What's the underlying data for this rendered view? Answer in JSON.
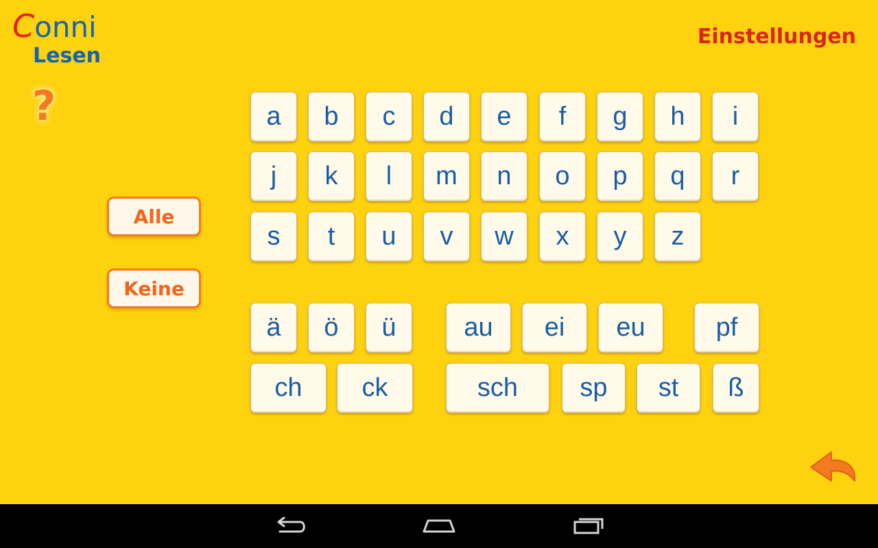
{
  "app": {
    "logo_line1_first": "C",
    "logo_line1_rest": "onni",
    "logo_line2": "Lesen",
    "help_symbol": "?",
    "settings_label": "Einstellungen",
    "colors": {
      "background": "#ffd20f",
      "key_text": "#1a5da4",
      "accent_orange": "#f47a20",
      "settings_red": "#d8261b"
    }
  },
  "side_buttons": {
    "all_label": "Alle",
    "none_label": "Keine"
  },
  "keys": {
    "row1": [
      "a",
      "b",
      "c",
      "d",
      "e",
      "f",
      "g",
      "h",
      "i"
    ],
    "row2": [
      "j",
      "k",
      "l",
      "m",
      "n",
      "o",
      "p",
      "q",
      "r"
    ],
    "row3": [
      "s",
      "t",
      "u",
      "v",
      "w",
      "x",
      "y",
      "z"
    ],
    "row4": [
      "ä",
      "ö",
      "ü",
      "au",
      "ei",
      "eu",
      "pf"
    ],
    "row5": [
      "ch",
      "ck",
      "sch",
      "sp",
      "st",
      "ß"
    ]
  },
  "icons": {
    "back": "back-arrow-icon",
    "nav": [
      "nav-back-icon",
      "nav-home-icon",
      "nav-recents-icon"
    ]
  }
}
